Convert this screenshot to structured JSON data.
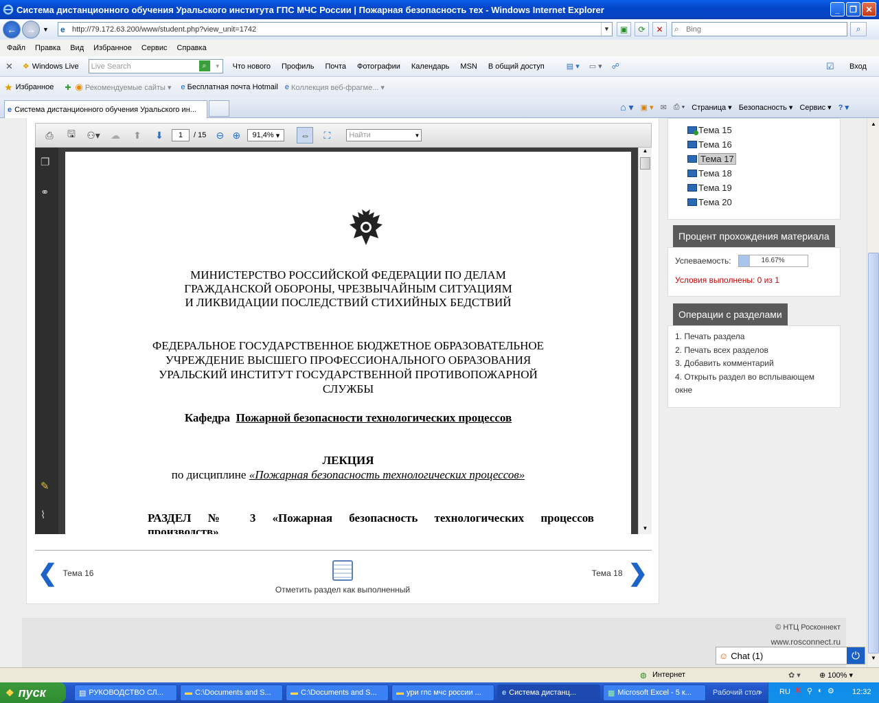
{
  "window": {
    "title": "Система дистанционного обучения Уральского института ГПС МЧС России | Пожарная безопасность тех - Windows Internet Explorer"
  },
  "address": {
    "url": "http://79.172.63.200/www/student.php?view_unit=1742",
    "search_placeholder": "Bing"
  },
  "menu": [
    "Файл",
    "Правка",
    "Вид",
    "Избранное",
    "Сервис",
    "Справка"
  ],
  "toolbar2": {
    "brand": "Windows Live",
    "search_placeholder": "Live Search",
    "items": [
      "Что нового",
      "Профиль",
      "Почта",
      "Фотографии",
      "Календарь",
      "MSN",
      "В общий доступ"
    ],
    "signin": "Вход"
  },
  "favorites": {
    "label": "Избранное",
    "items": [
      "Рекомендуемые сайты",
      "Бесплатная почта Hotmail",
      "Коллекция веб-фрагме..."
    ]
  },
  "tab": {
    "title": "Система дистанционного обучения Уральского ин..."
  },
  "commandbar": [
    "Страница",
    "Безопасность",
    "Сервис"
  ],
  "pdf": {
    "page_current": "1",
    "page_total": "/ 15",
    "zoom": "91,4%",
    "find_placeholder": "Найти",
    "lines": {
      "ministry1": "МИНИСТЕРСТВО РОССИЙСКОЙ ФЕДЕРАЦИИ ПО ДЕЛАМ",
      "ministry2": "ГРАЖДАНСКОЙ ОБОРОНЫ, ЧРЕЗВЫЧАЙНЫМ СИТУАЦИЯМ",
      "ministry3": "И ЛИКВИДАЦИИ ПОСЛЕДСТВИЙ СТИХИЙНЫХ БЕДСТВИЙ",
      "inst1": "ФЕДЕРАЛЬНОЕ ГОСУДАРСТВЕННОЕ БЮДЖЕТНОЕ ОБРАЗОВАТЕЛЬНОЕ",
      "inst2": "УЧРЕЖДЕНИЕ ВЫСШЕГО ПРОФЕССИОНАЛЬНОГО ОБРАЗОВАНИЯ",
      "inst3": "УРАЛЬСКИЙ ИНСТИТУТ ГОСУДАРСТВЕННОЙ ПРОТИВОПОЖАРНОЙ",
      "inst4": "СЛУЖБЫ",
      "dept_label": "Кафедра",
      "dept_name": "Пожарной безопасности технологических процессов",
      "lecture": "ЛЕКЦИЯ",
      "discipline_label": "по дисциплине",
      "discipline_name": "«Пожарная безопасность технологических процессов»",
      "section": "РАЗДЕЛ № 3 «Пожарная безопасность технологических процессов",
      "section_cont": "производств»"
    }
  },
  "nav": {
    "prev": "Тема 16",
    "next": "Тема 18",
    "mark": "Отметить раздел как выполненный"
  },
  "topics": [
    {
      "label": "Тема 15",
      "done": true
    },
    {
      "label": "Тема 16",
      "done": false
    },
    {
      "label": "Тема 17",
      "done": false,
      "selected": true
    },
    {
      "label": "Тема 18",
      "done": false
    },
    {
      "label": "Тема 19",
      "done": false
    },
    {
      "label": "Тема 20",
      "done": false
    }
  ],
  "progress": {
    "header": "Процент прохождения материала",
    "label": "Успеваемость:",
    "value": "16.67%",
    "fraction": 0.1667,
    "conditions": "Условия выполнены: 0 из 1"
  },
  "operations": {
    "header": "Операции с разделами",
    "items": [
      "1. Печать раздела",
      "2. Печать всех разделов",
      "3. Добавить комментарий",
      "4. Открыть раздел во всплывающем окне"
    ]
  },
  "footer": {
    "copyright": "© НТЦ Росконнект",
    "site": "www.rosconnect.ru"
  },
  "chat": {
    "label": "Chat (1)"
  },
  "status": {
    "zone": "Интернет",
    "zoom": "100%"
  },
  "taskbar": {
    "start": "пуск",
    "tasks": [
      "РУКОВОДСТВО СЛ...",
      "C:\\Documents and S...",
      "C:\\Documents and S...",
      "ури гпс мчс россии ...",
      "Система дистанц...",
      "Microsoft Excel - 5 к..."
    ],
    "desktop": "Рабочий стол",
    "lang": "RU",
    "time": "12:32"
  },
  "colors": {
    "accent": "#1d64c8",
    "header_bg": "#5a5a5a",
    "alert": "#cc0000"
  }
}
